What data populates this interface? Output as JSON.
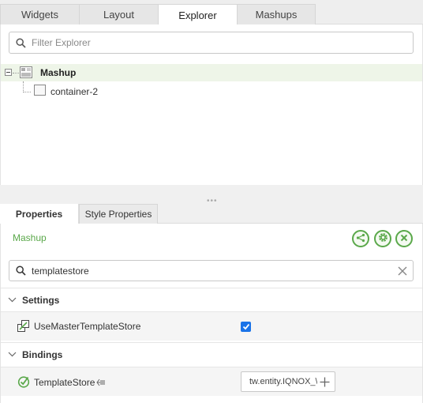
{
  "top_tabs": [
    {
      "label": "Widgets",
      "active": false
    },
    {
      "label": "Layout",
      "active": false
    },
    {
      "label": "Explorer",
      "active": true
    },
    {
      "label": "Mashups",
      "active": false
    }
  ],
  "explorer": {
    "filter_placeholder": "Filter Explorer",
    "tree": {
      "root": {
        "label": "Mashup",
        "icon": "mashup-icon",
        "expanded": true
      },
      "children": [
        {
          "label": "container-2",
          "icon": "container-icon"
        }
      ]
    }
  },
  "properties": {
    "tabs": [
      {
        "label": "Properties",
        "active": true
      },
      {
        "label": "Style Properties",
        "active": false
      }
    ],
    "entity_name": "Mashup",
    "actions": [
      "share-icon",
      "gear-icon",
      "close-icon"
    ],
    "search_value": "templatestore",
    "sections": [
      {
        "title": "Settings",
        "rows": [
          {
            "label": "UseMasterTemplateStore",
            "checked": true,
            "icon": "link-icon"
          }
        ]
      },
      {
        "title": "Bindings",
        "rows": [
          {
            "label": "TemplateStore",
            "value": "tw.entity.IQNOX_\\",
            "icon": "binding-check-icon"
          }
        ]
      }
    ]
  },
  "colors": {
    "accent_green": "#5aa84a",
    "checkbox_blue": "#1a73e8"
  }
}
